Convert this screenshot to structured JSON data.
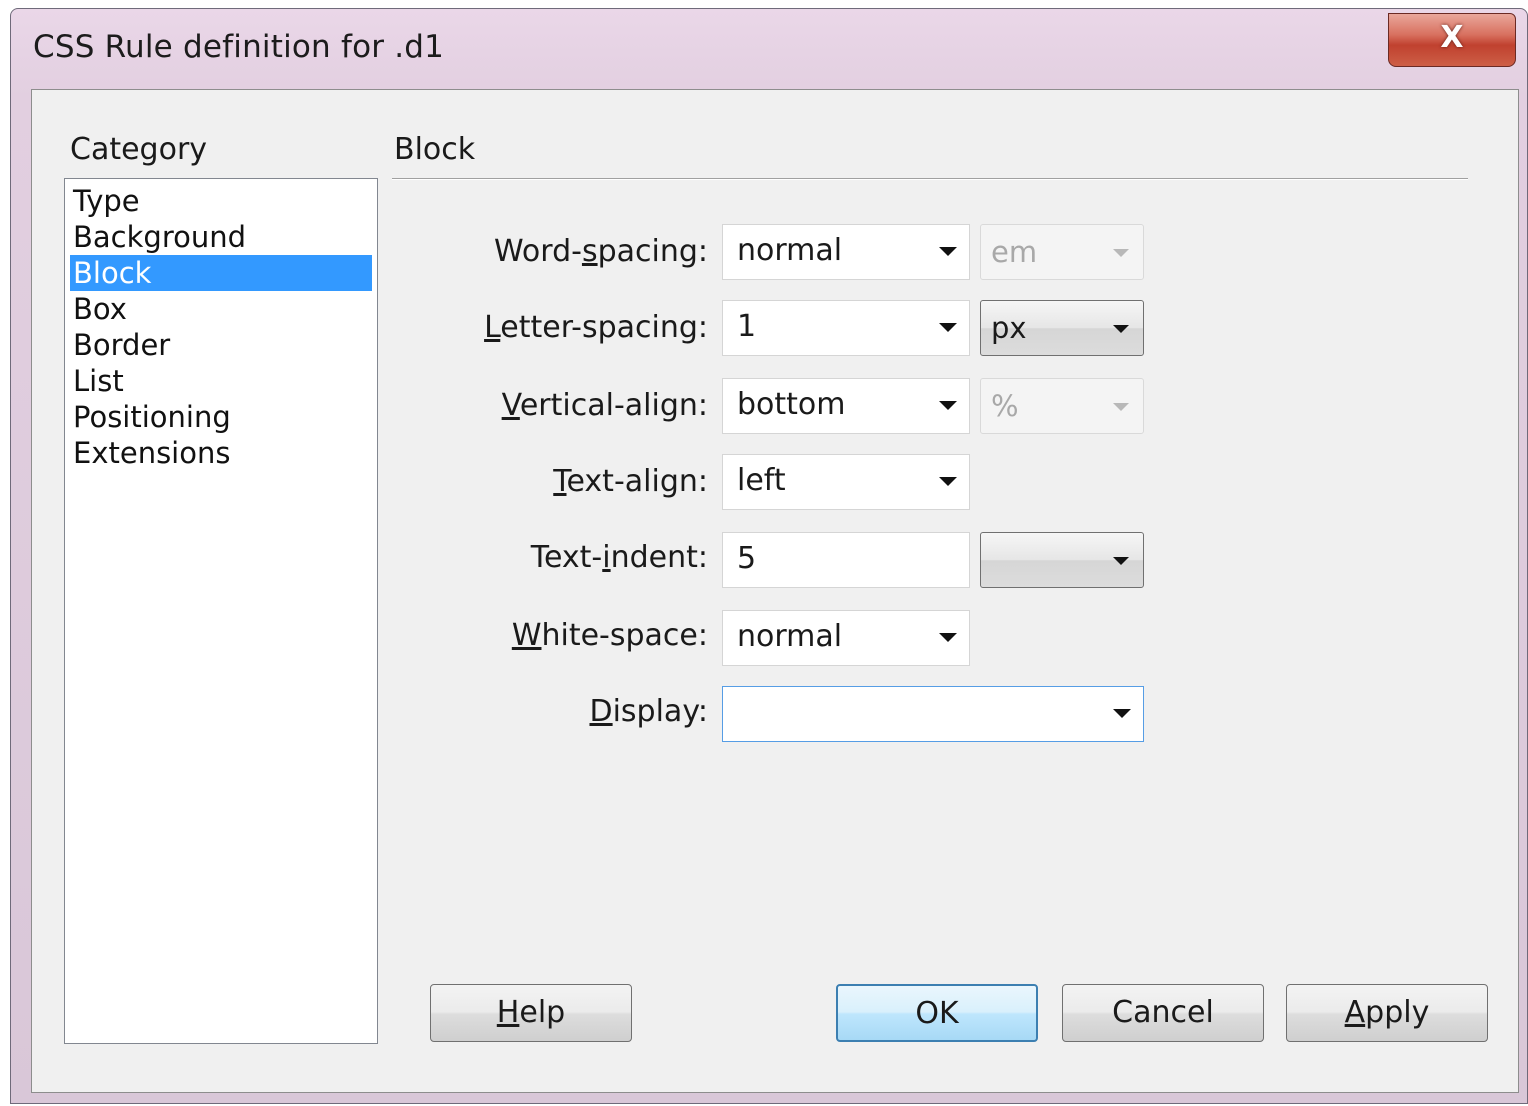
{
  "window": {
    "title": "CSS Rule definition for .d1",
    "close_glyph": "X"
  },
  "category": {
    "label": "Category",
    "items": [
      "Type",
      "Background",
      "Block",
      "Box",
      "Border",
      "List",
      "Positioning",
      "Extensions"
    ],
    "selected": "Block"
  },
  "section": {
    "title": "Block"
  },
  "fields": {
    "word_spacing": {
      "label_pre": "Word-",
      "label_u": "s",
      "label_post": "pacing:",
      "value": "normal",
      "unit": "em",
      "unit_enabled": false
    },
    "letter_spacing": {
      "label_pre": "",
      "label_u": "L",
      "label_post": "etter-spacing:",
      "value": "1",
      "unit": "px",
      "unit_enabled": true
    },
    "vertical_align": {
      "label_pre": "",
      "label_u": "V",
      "label_post": "ertical-align:",
      "value": "bottom",
      "unit": "%",
      "unit_enabled": false
    },
    "text_align": {
      "label_pre": "",
      "label_u": "T",
      "label_post": "ext-align:",
      "value": "left"
    },
    "text_indent": {
      "label_pre": "Text-",
      "label_u": "i",
      "label_post": "ndent:",
      "value": "5",
      "unit": "",
      "unit_enabled": true
    },
    "white_space": {
      "label_pre": "",
      "label_u": "W",
      "label_post": "hite-space:",
      "value": "normal"
    },
    "display": {
      "label_pre": "",
      "label_u": "D",
      "label_post": "isplay:",
      "value": ""
    }
  },
  "buttons": {
    "help": {
      "u": "H",
      "rest": "elp"
    },
    "ok": "OK",
    "cancel": "Cancel",
    "apply": {
      "u": "A",
      "rest": "pply"
    }
  },
  "colors": {
    "selection": "#3399ff",
    "close_button": "#c0412f",
    "default_button_border": "#3c7fb1"
  }
}
